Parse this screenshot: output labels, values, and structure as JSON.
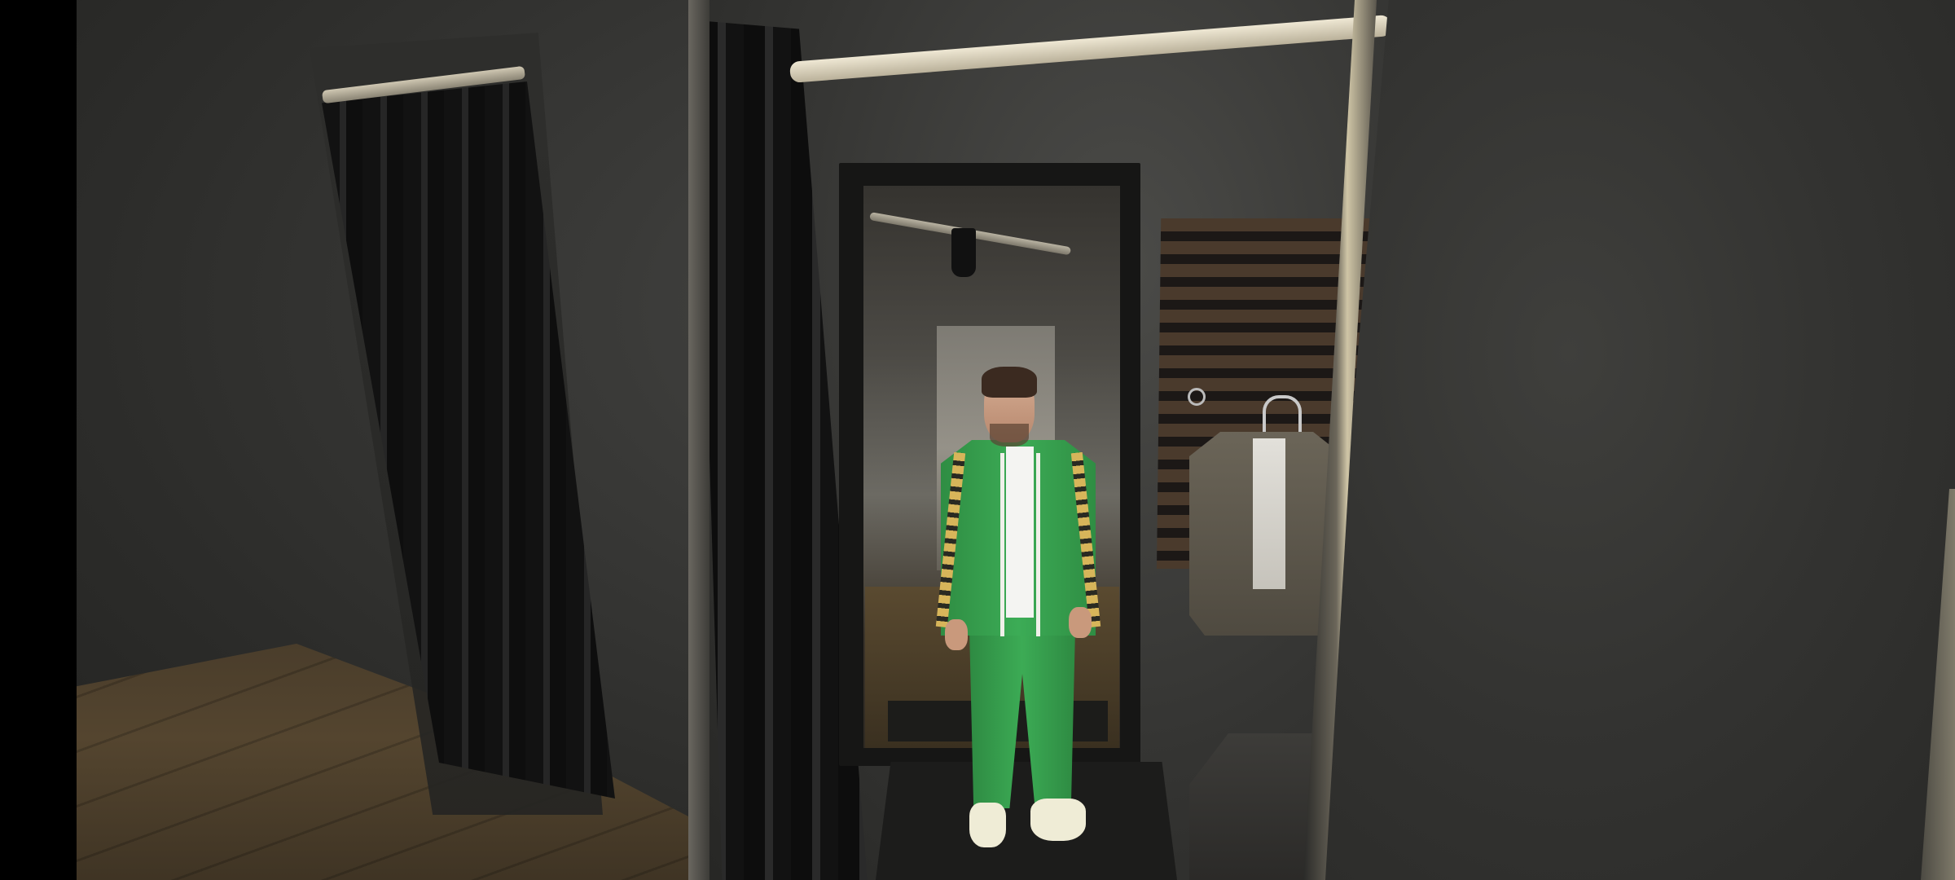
{
  "scene": {
    "description_visible_text": "",
    "character_outfit": {
      "jacket_color": "#3CAB55",
      "pants_color": "#3CAB55",
      "shirt_color": "#F4F4F2",
      "shoe_color": "#EFECD6",
      "trim_color": "#D7B55A"
    },
    "environment_colors": {
      "wall": "#3A3A38",
      "floor": "#54452F",
      "curtain": "#121212",
      "rod": "#EFE8D4"
    }
  }
}
